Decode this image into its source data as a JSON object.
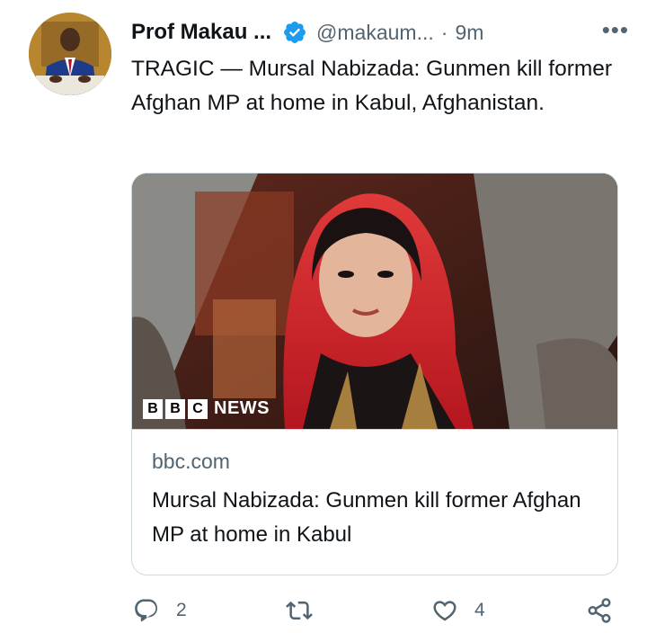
{
  "tweet": {
    "author": {
      "name": "Prof Makau ...",
      "handle": "@makaum...",
      "separator": "·",
      "time": "9m",
      "avatar_icon": "profile-photo",
      "verified_icon": "verified-badge-icon"
    },
    "more_label": "•••",
    "text": "TRAGIC — Mursal Nabizada: Gunmen kill former Afghan MP at home in Kabul, Afghanistan."
  },
  "card": {
    "logo_letters": [
      "B",
      "B",
      "C"
    ],
    "logo_word": "NEWS",
    "domain": "bbc.com",
    "title": "Mursal Nabizada: Gunmen kill former Afghan MP at home in Kabul"
  },
  "actions": {
    "reply": {
      "icon": "reply-icon",
      "count": "2"
    },
    "retweet": {
      "icon": "retweet-icon",
      "count": ""
    },
    "like": {
      "icon": "heart-icon",
      "count": "4"
    },
    "share": {
      "icon": "share-icon"
    }
  },
  "colors": {
    "text": "#0f1419",
    "secondary": "#536471",
    "verified": "#1d9bf0",
    "border": "#cfd9de"
  }
}
